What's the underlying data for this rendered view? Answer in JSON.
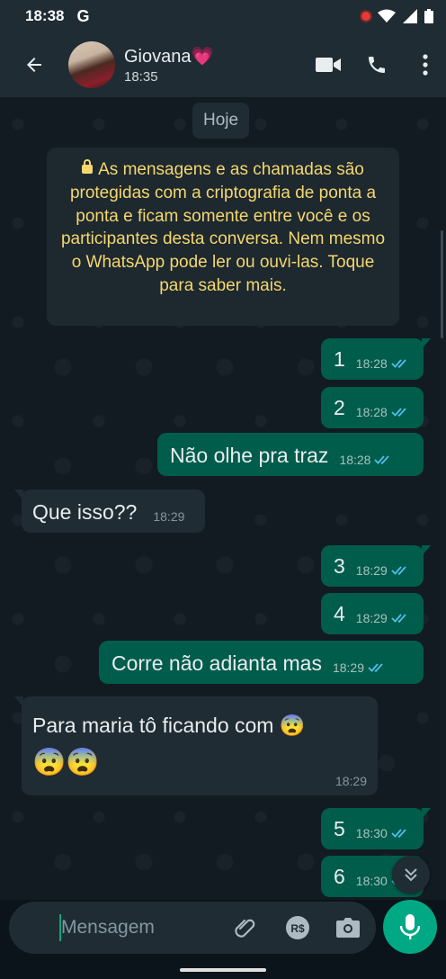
{
  "status_bar": {
    "time": "18:38",
    "google_badge": "G"
  },
  "header": {
    "contact_name": "Giovana💗",
    "last_seen": "18:35",
    "icons": [
      "back-arrow-icon",
      "video-call-icon",
      "phone-icon",
      "more-vert-icon"
    ]
  },
  "chat": {
    "date_chip": "Hoje",
    "encryption_notice": "As mensagens e as chamadas são protegidas com a criptografia de ponta a ponta e ficam somente entre você e os participantes desta conversa. Nem mesmo o WhatsApp pode ler ou ouvi-las. Toque para saber mais.",
    "messages": [
      {
        "direction": "out",
        "text": "1",
        "time": "18:28",
        "status": "read"
      },
      {
        "direction": "out",
        "text": "2",
        "time": "18:28",
        "status": "read"
      },
      {
        "direction": "out",
        "text": "Não olhe pra traz",
        "time": "18:28",
        "status": "read"
      },
      {
        "direction": "in",
        "text": "Que isso??",
        "time": "18:29"
      },
      {
        "direction": "out",
        "text": "3",
        "time": "18:29",
        "status": "read"
      },
      {
        "direction": "out",
        "text": "4",
        "time": "18:29",
        "status": "read"
      },
      {
        "direction": "out",
        "text": "Corre não adianta mas",
        "time": "18:29",
        "status": "read"
      },
      {
        "direction": "in",
        "text_line1": "Para maria tô ficando com 😨",
        "text_line2": "😨😨",
        "time": "18:29"
      },
      {
        "direction": "out",
        "text": "5",
        "time": "18:30",
        "status": "read"
      },
      {
        "direction": "out",
        "text": "6",
        "time": "18:30",
        "status": "read"
      }
    ]
  },
  "composer": {
    "placeholder": "Mensagem",
    "icons": [
      "attach-icon",
      "payment-icon",
      "camera-icon",
      "mic-icon"
    ]
  },
  "colors": {
    "accent": "#00a884",
    "outgoing_bubble": "#005c4b",
    "incoming_bubble": "#202c33",
    "header": "#1f2c33",
    "read_ticks": "#53bdeb",
    "encryption_text": "#f5d76e"
  }
}
